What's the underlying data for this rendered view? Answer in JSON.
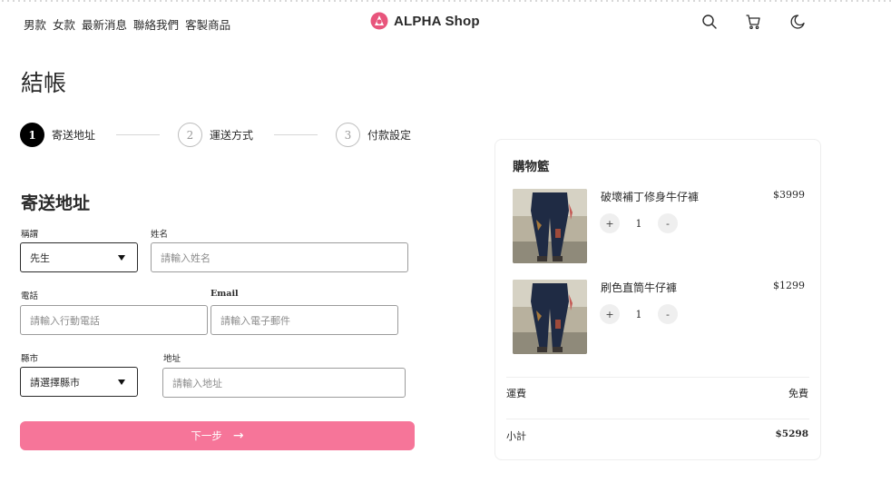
{
  "header": {
    "nav_items": [
      "男款",
      "女款",
      "最新消息",
      "聯絡我們",
      "客製商品"
    ],
    "logo_text": "ALPHA Shop",
    "icons": [
      "search-icon",
      "cart-icon",
      "moon-icon"
    ]
  },
  "checkout": {
    "title": "結帳",
    "steps": [
      {
        "number": "1",
        "label": "寄送地址",
        "state": "active"
      },
      {
        "number": "2",
        "label": "運送方式",
        "state": "inactive"
      },
      {
        "number": "3",
        "label": "付款設定",
        "state": "inactive"
      }
    ]
  },
  "form": {
    "title": "寄送地址",
    "salutation": {
      "label": "稱謂",
      "value": "先生"
    },
    "name": {
      "label": "姓名",
      "placeholder": "請輸入姓名"
    },
    "phone": {
      "label": "電話",
      "placeholder": "請輸入行動電話"
    },
    "email": {
      "label": "Email",
      "placeholder": "請輸入電子郵件"
    },
    "city": {
      "label": "縣市",
      "value": "請選擇縣市"
    },
    "address": {
      "label": "地址",
      "placeholder": "請輸入地址"
    },
    "next_button": {
      "label": "下一步",
      "arrow": "→"
    }
  },
  "cart": {
    "title": "購物籃",
    "items": [
      {
        "name": "破壞補丁修身牛仔褲",
        "price": "$3999",
        "quantity": "1",
        "plus": "+",
        "minus": "-"
      },
      {
        "name": "刷色直筒牛仔褲",
        "price": "$1299",
        "quantity": "1",
        "plus": "+",
        "minus": "-"
      }
    ],
    "shipping_label": "運費",
    "shipping_value": "免費",
    "subtotal_label": "小計",
    "subtotal_value": "$5298"
  },
  "colors": {
    "accent": "#f67599",
    "logo_pink": "#e8557c",
    "active_step": "#000000"
  }
}
